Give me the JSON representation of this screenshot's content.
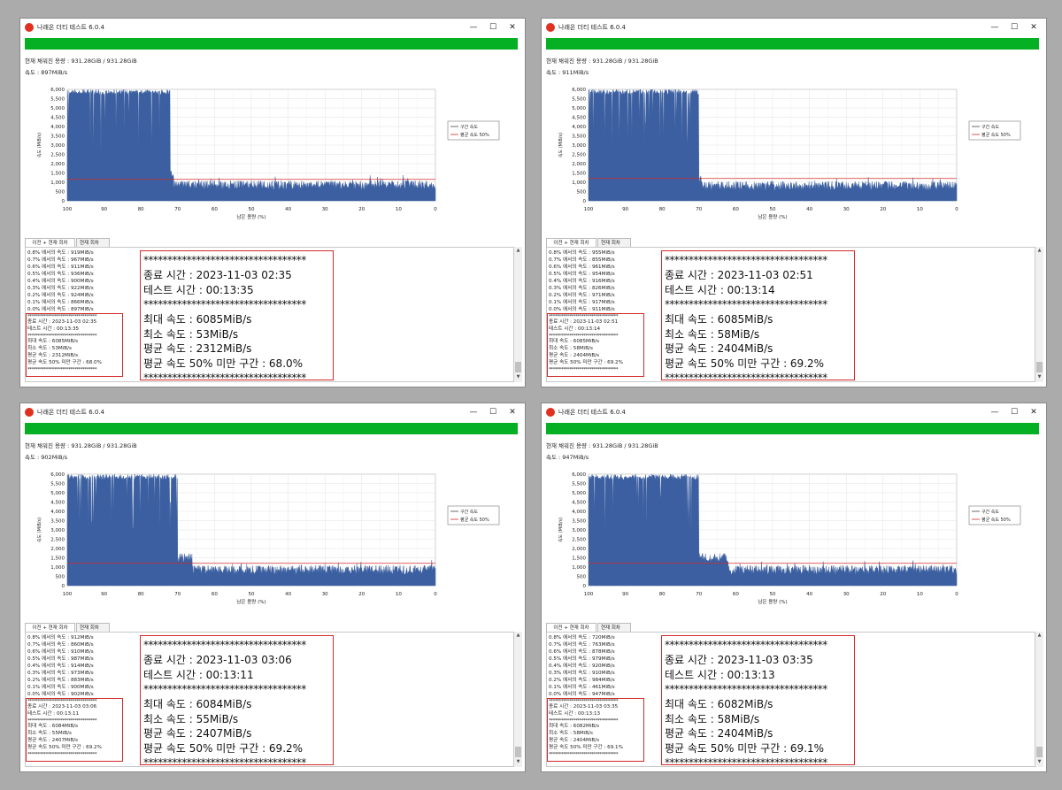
{
  "accent": "#06b025",
  "series_color": "#3b5fa0",
  "avg_line_color": "#d42a2a",
  "windows": [
    {
      "title": "나래온 더티 테스트 6.0.4",
      "progress": 1.0,
      "capacity": "현재 채워진 용량 : 931.28GiB / 931.28GiB",
      "speed": "속도 : 897MiB/s",
      "log_lines": [
        "0.8% 에서의 속도 : 919MiB/s",
        "0.7% 에서의 속도 : 967MiB/s",
        "0.6% 에서의 속도 : 911MiB/s",
        "0.5% 에서의 속도 : 936MiB/s",
        "0.4% 에서의 속도 : 900MiB/s",
        "0.3% 에서의 속도 : 922MiB/s",
        "0.2% 에서의 속도 : 924MiB/s",
        "0.1% 에서의 속도 : 866MiB/s",
        "0.0% 에서의 속도 : 897MiB/s"
      ],
      "summary": {
        "end_time": "종료 시간 : 2023-11-03 02:35",
        "test_time": "테스트 시간 : 00:13:35",
        "max": "최대 속도 : 6085MiB/s",
        "min": "최소 속도 : 53MiB/s",
        "avg": "평균 속도 : 2312MiB/s",
        "below50": "평균 속도 50% 미만 구간 : 68.0%"
      },
      "chart_data": {
        "type": "area",
        "xlabel": "남은 용량 (%)",
        "ylabel": "속도 (MiB/s)",
        "xlim": [
          100,
          0
        ],
        "ylim": [
          0,
          6000
        ],
        "grid": true,
        "legend_position": "right",
        "avg_line": 1156,
        "profile": {
          "cache_end": 72,
          "cache_level": 6000,
          "cache_dip_low": 2400,
          "mid_end": 71,
          "mid_level": 1450,
          "post_level": 850,
          "post_noise": 250
        },
        "series": [
          {
            "name": "구간 속도"
          },
          {
            "name": "평균 속도 50%"
          }
        ]
      }
    },
    {
      "title": "나래온 더티 테스트 6.0.4",
      "progress": 1.0,
      "capacity": "현재 채워진 용량 : 931.28GiB / 931.28GiB",
      "speed": "속도 : 911MiB/s",
      "log_lines": [
        "0.8% 에서의 속도 : 955MiB/s",
        "0.7% 에서의 속도 : 855MiB/s",
        "0.6% 에서의 속도 : 961MiB/s",
        "0.5% 에서의 속도 : 954MiB/s",
        "0.4% 에서의 속도 : 916MiB/s",
        "0.3% 에서의 속도 : 826MiB/s",
        "0.2% 에서의 속도 : 971MiB/s",
        "0.1% 에서의 속도 : 917MiB/s",
        "0.0% 에서의 속도 : 911MiB/s"
      ],
      "summary": {
        "end_time": "종료 시간 : 2023-11-03 02:51",
        "test_time": "테스트 시간 : 00:13:14",
        "max": "최대 속도 : 6085MiB/s",
        "min": "최소 속도 : 58MiB/s",
        "avg": "평균 속도 : 2404MiB/s",
        "below50": "평균 속도 50% 미만 구간 : 69.2%"
      },
      "chart_data": {
        "type": "area",
        "xlabel": "남은 용량 (%)",
        "ylabel": "속도 (MiB/s)",
        "xlim": [
          100,
          0
        ],
        "ylim": [
          0,
          6000
        ],
        "grid": true,
        "legend_position": "right",
        "avg_line": 1202,
        "profile": {
          "cache_end": 70,
          "cache_level": 6000,
          "cache_dip_low": 2400,
          "mid_end": 69,
          "mid_level": 1200,
          "post_level": 800,
          "post_noise": 250
        },
        "series": [
          {
            "name": "구간 속도"
          },
          {
            "name": "평균 속도 50%"
          }
        ]
      }
    },
    {
      "title": "나래온 더티 테스트 6.0.4",
      "progress": 1.0,
      "capacity": "현재 채워진 용량 : 931.28GiB / 931.28GiB",
      "speed": "속도 : 902MiB/s",
      "log_lines": [
        "0.8% 에서의 속도 : 912MiB/s",
        "0.7% 에서의 속도 : 860MiB/s",
        "0.6% 에서의 속도 : 910MiB/s",
        "0.5% 에서의 속도 : 987MiB/s",
        "0.4% 에서의 속도 : 914MiB/s",
        "0.3% 에서의 속도 : 973MiB/s",
        "0.2% 에서의 속도 : 883MiB/s",
        "0.1% 에서의 속도 : 900MiB/s",
        "0.0% 에서의 속도 : 902MiB/s"
      ],
      "summary": {
        "end_time": "종료 시간 : 2023-11-03 03:06",
        "test_time": "테스트 시간 : 00:13:11",
        "max": "최대 속도 : 6084MiB/s",
        "min": "최소 속도 : 55MiB/s",
        "avg": "평균 속도 : 2407MiB/s",
        "below50": "평균 속도 50% 미만 구간 : 69.2%"
      },
      "chart_data": {
        "type": "area",
        "xlabel": "남은 용량 (%)",
        "ylabel": "속도 (MiB/s)",
        "xlim": [
          100,
          0
        ],
        "ylim": [
          0,
          6000
        ],
        "grid": true,
        "legend_position": "right",
        "avg_line": 1203,
        "profile": {
          "cache_end": 70,
          "cache_level": 6000,
          "cache_dip_low": 2400,
          "mid_end": 66,
          "mid_level": 1500,
          "post_level": 850,
          "post_noise": 250
        },
        "series": [
          {
            "name": "구간 속도"
          },
          {
            "name": "평균 속도 50%"
          }
        ]
      }
    },
    {
      "title": "나래온 더티 테스트 6.0.4",
      "progress": 1.0,
      "capacity": "현재 채워진 용량 : 931.28GiB / 931.28GiB",
      "speed": "속도 : 947MiB/s",
      "log_lines": [
        "0.8% 에서의 속도 : 720MiB/s",
        "0.7% 에서의 속도 : 763MiB/s",
        "0.6% 에서의 속도 : 878MiB/s",
        "0.5% 에서의 속도 : 979MiB/s",
        "0.4% 에서의 속도 : 920MiB/s",
        "0.3% 에서의 속도 : 910MiB/s",
        "0.2% 에서의 속도 : 984MiB/s",
        "0.1% 에서의 속도 : 461MiB/s",
        "0.0% 에서의 속도 : 947MiB/s"
      ],
      "summary": {
        "end_time": "종료 시간 : 2023-11-03 03:35",
        "test_time": "테스트 시간 : 00:13:13",
        "max": "최대 속도 : 6082MiB/s",
        "min": "최소 속도 : 58MiB/s",
        "avg": "평균 속도 : 2404MiB/s",
        "below50": "평균 속도 50% 미만 구간 : 69.1%"
      },
      "chart_data": {
        "type": "area",
        "xlabel": "남은 용량 (%)",
        "ylabel": "속도 (MiB/s)",
        "xlim": [
          100,
          0
        ],
        "ylim": [
          0,
          6000
        ],
        "grid": true,
        "legend_position": "right",
        "avg_line": 1202,
        "profile": {
          "cache_end": 70,
          "cache_level": 6000,
          "cache_dip_low": 2400,
          "mid_end": 62,
          "mid_level": 1500,
          "post_level": 850,
          "post_noise": 250
        },
        "series": [
          {
            "name": "구간 속도"
          },
          {
            "name": "평균 속도 50%"
          }
        ]
      }
    }
  ],
  "tabs": [
    "이전 + 현재 회차",
    "현재 회차"
  ],
  "separator": "**********************************",
  "ytick_labels": [
    "6,000",
    "5,500",
    "5,000",
    "4,500",
    "4,000",
    "3,500",
    "3,000",
    "2,500",
    "2,000",
    "1,500",
    "1,000",
    "500",
    "0"
  ],
  "xtick_labels": [
    "100",
    "90",
    "80",
    "70",
    "60",
    "50",
    "40",
    "30",
    "20",
    "10",
    "0"
  ],
  "window_controls": {
    "minimize": "—",
    "maximize": "☐",
    "close": "✕"
  },
  "scroll_controls": {
    "up": "▲",
    "down": "▼"
  }
}
